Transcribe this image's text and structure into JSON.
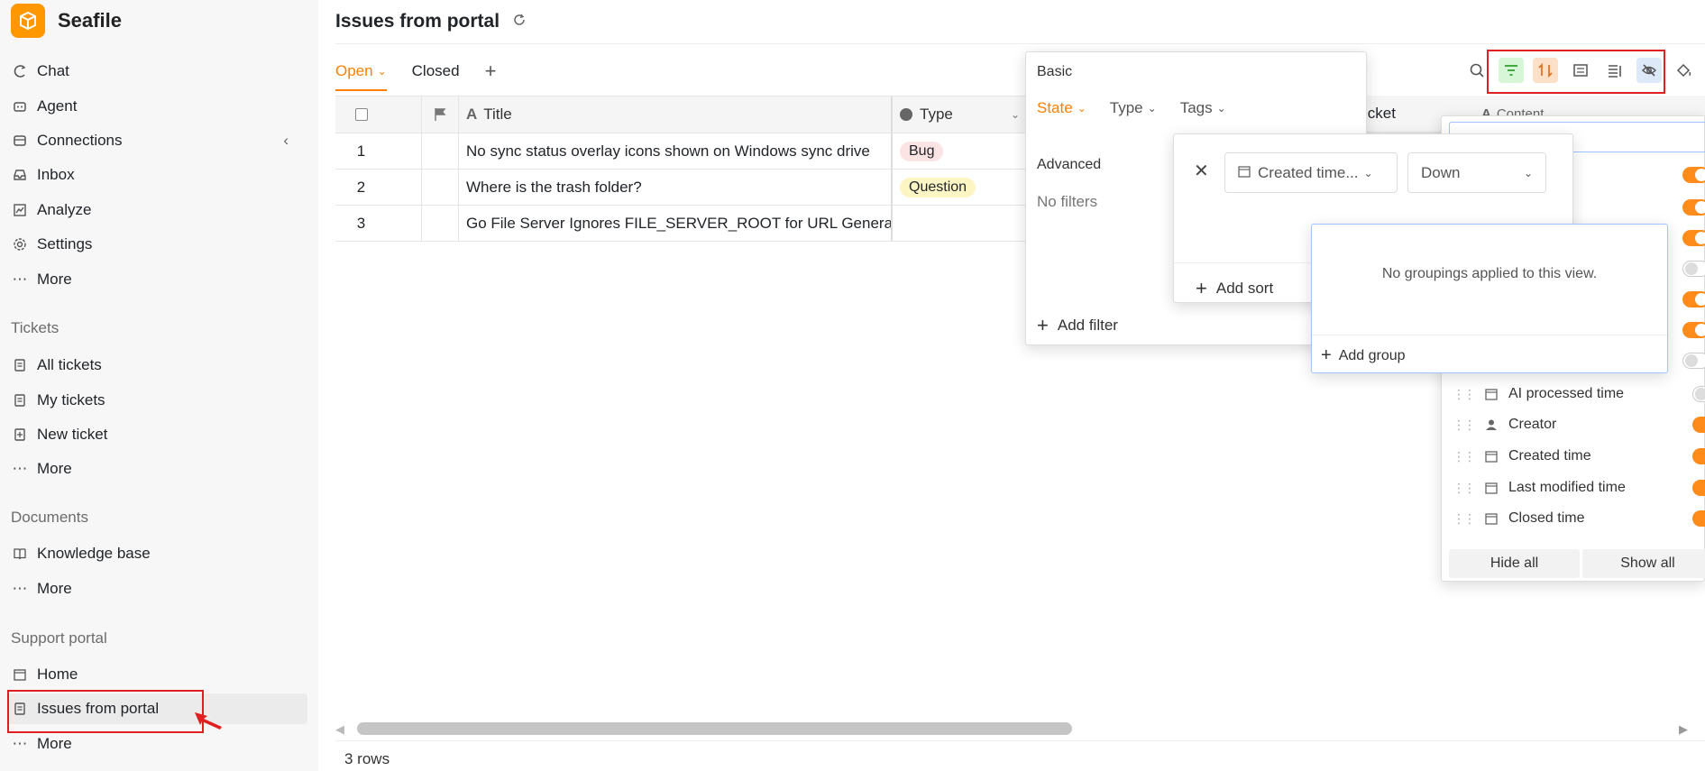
{
  "app": {
    "name": "Seafile",
    "brand_color": "#ff9800"
  },
  "sidebar": {
    "top_items": [
      {
        "label": "Chat",
        "icon": "chat-icon"
      },
      {
        "label": "Agent",
        "icon": "agent-icon"
      },
      {
        "label": "Connections",
        "icon": "connections-icon"
      },
      {
        "label": "Inbox",
        "icon": "inbox-icon"
      },
      {
        "label": "Analyze",
        "icon": "analyze-icon"
      },
      {
        "label": "Settings",
        "icon": "gear-icon"
      },
      {
        "label": "More",
        "icon": "ellipsis-icon"
      }
    ],
    "tickets": {
      "title": "Tickets",
      "items": [
        {
          "label": "All tickets"
        },
        {
          "label": "My tickets"
        },
        {
          "label": "New ticket"
        },
        {
          "label": "More"
        }
      ]
    },
    "documents": {
      "title": "Documents",
      "items": [
        {
          "label": "Knowledge base"
        },
        {
          "label": "More"
        }
      ]
    },
    "support_portal": {
      "title": "Support portal",
      "items": [
        {
          "label": "Home"
        },
        {
          "label": "Issues from portal"
        },
        {
          "label": "More"
        }
      ]
    }
  },
  "main": {
    "title": "Issues from portal",
    "tabs": [
      {
        "label": "Open",
        "active": true
      },
      {
        "label": "Closed",
        "active": false
      }
    ],
    "table": {
      "columns": [
        "Title",
        "Type",
        "icket",
        "Content"
      ],
      "rows": [
        {
          "num": "1",
          "title": "No sync status overlay icons shown on Windows sync drive",
          "type": "Bug",
          "type_color": "#fde4e4"
        },
        {
          "num": "2",
          "title": "Where is the trash folder?",
          "type": "Question",
          "type_color": "#fdf6c4"
        },
        {
          "num": "3",
          "title": "Go File Server Ignores FILE_SERVER_ROOT for URL Generation",
          "type": "",
          "type_color": ""
        }
      ]
    },
    "footer": {
      "row_count": "3 rows"
    }
  },
  "filter_popup": {
    "basic_label": "Basic",
    "basic_filters": [
      "State",
      "Type",
      "Tags"
    ],
    "advanced_label": "Advanced",
    "no_filters": "No filters",
    "add_filter": "Add filter"
  },
  "sort_popup": {
    "field": "Created time...",
    "direction": "Down",
    "add_sort": "Add sort"
  },
  "group_popup": {
    "empty_text": "No groupings applied to this view.",
    "add_group": "Add group"
  },
  "hide_popup": {
    "fields": [
      {
        "label": "AI processed time",
        "icon": "calendar-icon",
        "on": false
      },
      {
        "label": "Creator",
        "icon": "person-icon",
        "on": true
      },
      {
        "label": "Created time",
        "icon": "calendar-icon",
        "on": true
      },
      {
        "label": "Last modified time",
        "icon": "calendar-icon",
        "on": true
      },
      {
        "label": "Closed time",
        "icon": "calendar-icon",
        "on": true
      }
    ],
    "hide_all": "Hide all",
    "show_all": "Show all"
  }
}
